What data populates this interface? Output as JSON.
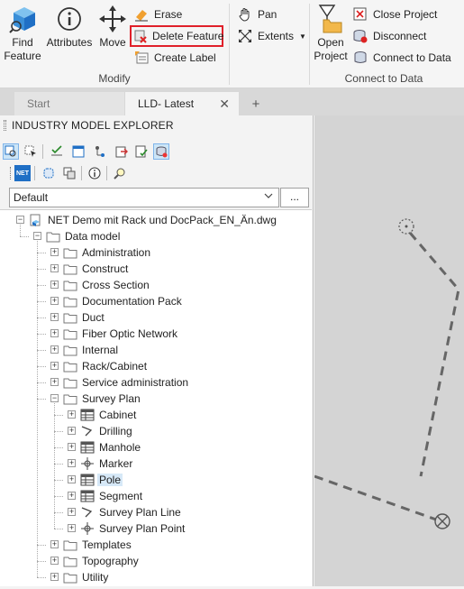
{
  "ribbon": {
    "find_feature": "Find\nFeature",
    "attributes": "Attributes",
    "move": "Move",
    "erase": "Erase",
    "delete_feature": "Delete Feature",
    "create_label": "Create Label",
    "modify_group": "Modify",
    "pan": "Pan",
    "extents": "Extents",
    "open_project": "Open\nProject",
    "close_project": "Close Project",
    "disconnect": "Disconnect",
    "connect_to_data": "Connect to Data",
    "connect_group": "Connect to Data"
  },
  "tabs": {
    "start": "Start",
    "current": "LLD- Latest",
    "close_glyph": "✕",
    "add_glyph": "+"
  },
  "panel": {
    "title": "INDUSTRY MODEL EXPLORER",
    "combo_value": "Default",
    "combo_more": "...",
    "net_label": "NET"
  },
  "tree": {
    "root": "NET Demo mit Rack und DocPack_EN_Än.dwg",
    "data_model": "Data model",
    "folders_top": [
      "Administration",
      "Construct",
      "Cross Section",
      "Documentation Pack",
      "Duct",
      "Fiber Optic Network",
      "Internal",
      "Rack/Cabinet",
      "Service administration",
      "Survey Plan"
    ],
    "survey_items": [
      {
        "label": "Cabinet",
        "icon": "table-icon"
      },
      {
        "label": "Drilling",
        "icon": "line-icon"
      },
      {
        "label": "Manhole",
        "icon": "table-icon"
      },
      {
        "label": "Marker",
        "icon": "point-icon"
      },
      {
        "label": "Pole",
        "icon": "table-icon",
        "selected": true
      },
      {
        "label": "Segment",
        "icon": "table-icon"
      },
      {
        "label": "Survey Plan Line",
        "icon": "line-icon"
      },
      {
        "label": "Survey Plan Point",
        "icon": "point-icon"
      }
    ],
    "folders_bottom": [
      "Templates",
      "Topography",
      "Utility"
    ]
  },
  "colors": {
    "highlight_border": "#e0202a",
    "selection": "#d6e8f7",
    "canvas": "#d4d4d4",
    "accent_blue": "#1f6fc5"
  }
}
